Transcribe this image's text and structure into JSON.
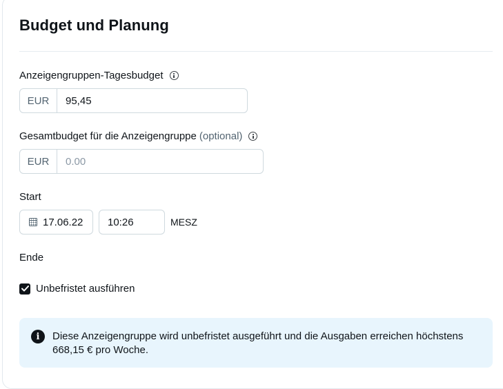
{
  "section": {
    "title": "Budget und Planung"
  },
  "daily_budget": {
    "label": "Anzeigengruppen-Tagesbudget",
    "currency": "EUR",
    "value": "95,45"
  },
  "total_budget": {
    "label": "Gesamtbudget für die Anzeigengruppe",
    "optional_label": "(optional)",
    "currency": "EUR",
    "placeholder": "0.00"
  },
  "start": {
    "label": "Start",
    "date": "17.06.22",
    "time": "10:26",
    "timezone": "MESZ"
  },
  "end": {
    "label": "Ende",
    "checkbox_label": "Unbefristet ausführen",
    "checked": true
  },
  "notice": {
    "icon": "info-filled-icon",
    "text": "Diese Anzeigengruppe wird unbefristet ausgeführt und die Ausgaben erreichen höchstens 668,15 € pro Woche."
  },
  "colors": {
    "border": "#cfd9de",
    "notice_background": "#e8f5fd",
    "text": "#0f1419",
    "muted": "#536471"
  }
}
